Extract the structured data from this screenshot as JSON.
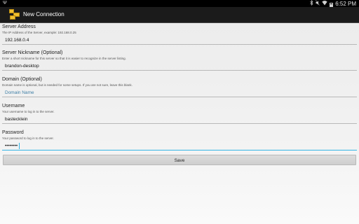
{
  "status_bar": {
    "usb_icon": "usb-icon",
    "clock": "6:52 PM",
    "icons": [
      "bluetooth-icon",
      "mute-icon",
      "wifi-icon",
      "battery-icon"
    ]
  },
  "action_bar": {
    "app_icon": "folder-icon",
    "title": "New Connection"
  },
  "fields": {
    "server_address": {
      "label": "Server Address",
      "hint": "The IP Address of the Server, example: 192.168.0.25",
      "value": "192.168.0.4"
    },
    "nickname": {
      "label": "Server Nickname (Optional)",
      "hint": "Enter a short nickname for this server so that it is easier to recognize in the server listing.",
      "value": "brandon-desktop"
    },
    "domain": {
      "label": "Domain (Optional)",
      "hint": "Domain name is optional, but is needed for some setups. If you are not sure, leave this blank.",
      "placeholder": "Domain Name",
      "value": ""
    },
    "username": {
      "label": "Username",
      "hint": "Your username to log in to the server.",
      "value": "bastecklein"
    },
    "password": {
      "label": "Password",
      "hint": "Your password to log in to the server.",
      "value": "••••••••"
    }
  },
  "save_label": "Save",
  "colors": {
    "accent": "#33b5e5",
    "actionbar": "#1b1b1b",
    "statusbar": "#000000"
  }
}
